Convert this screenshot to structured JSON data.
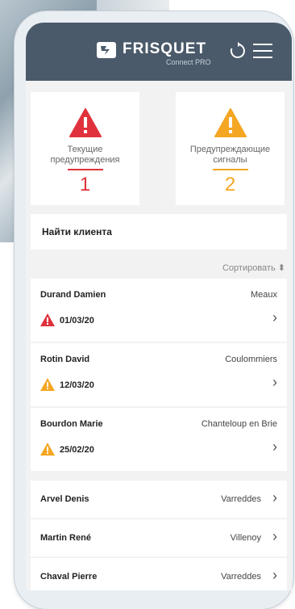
{
  "header": {
    "brand": "FRISQUET",
    "subbrand": "Connect PRO"
  },
  "alerts": [
    {
      "label_line1": "Текущие",
      "label_line2": "предупреждения",
      "count": "1",
      "color": "#e0323c"
    },
    {
      "label_line1": "Предупреждающие",
      "label_line2": "сигналы",
      "count": "2",
      "color": "#f5a623"
    }
  ],
  "search": {
    "label": "Найти клиента"
  },
  "sort": {
    "label": "Сортировать"
  },
  "clients": [
    {
      "name": "Durand Damien",
      "city": "Meaux",
      "date": "01/03/20",
      "level": "red"
    },
    {
      "name": "Rotin David",
      "city": "Coulommiers",
      "date": "12/03/20",
      "level": "orange"
    },
    {
      "name": "Bourdon Marie",
      "city": "Chanteloup en Brie",
      "date": "25/02/20",
      "level": "orange"
    },
    {
      "name": "Arvel Denis",
      "city": "Varreddes"
    },
    {
      "name": "Martin René",
      "city": "Villenoy"
    },
    {
      "name": "Chaval Pierre",
      "city": "Varreddes"
    }
  ],
  "colors": {
    "header": "#4a5a6a",
    "danger": "#e0323c",
    "warning": "#f5a623"
  }
}
